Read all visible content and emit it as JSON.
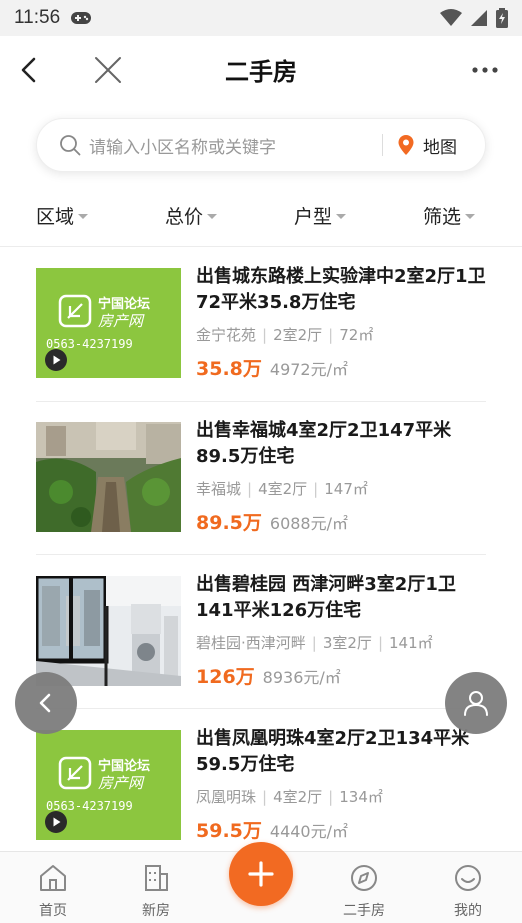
{
  "status_bar": {
    "time": "11:56"
  },
  "nav": {
    "title": "二手房"
  },
  "search": {
    "placeholder": "请输入小区名称或关键字",
    "map_label": "地图"
  },
  "filters": [
    "区域",
    "总价",
    "户型",
    "筛选"
  ],
  "listings": [
    {
      "title": "出售城东路楼上实验津中2室2厅1卫72平米35.8万住宅",
      "community": "金宁花苑",
      "layout": "2室2厅",
      "area": "72㎡",
      "price": "35.8万",
      "unit_price": "4972元/㎡",
      "thumb_brand": "宁国论坛",
      "thumb_sub": "房产网",
      "thumb_phone": "0563-4237199"
    },
    {
      "title": "出售幸福城4室2厅2卫147平米89.5万住宅",
      "community": "幸福城",
      "layout": "4室2厅",
      "area": "147㎡",
      "price": "89.5万",
      "unit_price": "6088元/㎡"
    },
    {
      "title": "出售碧桂园 西津河畔3室2厅1卫141平米126万住宅",
      "community": "碧桂园·西津河畔",
      "layout": "3室2厅",
      "area": "141㎡",
      "price": "126万",
      "unit_price": "8936元/㎡"
    },
    {
      "title": "出售凤凰明珠4室2厅2卫134平米59.5万住宅",
      "community": "凤凰明珠",
      "layout": "4室2厅",
      "area": "134㎡",
      "price": "59.5万",
      "unit_price": "4440元/㎡",
      "thumb_brand": "宁国论坛",
      "thumb_sub": "房产网",
      "thumb_phone": "0563-4237199"
    }
  ],
  "tabs": [
    {
      "label": "首页",
      "icon": "home-icon"
    },
    {
      "label": "新房",
      "icon": "building-icon"
    },
    {
      "label": "",
      "icon": "plus-icon"
    },
    {
      "label": "二手房",
      "icon": "compass-icon"
    },
    {
      "label": "我的",
      "icon": "smile-icon"
    }
  ],
  "colors": {
    "accent": "#f26a22",
    "price": "#f06a1f",
    "thumb_green": "#8cc63f"
  }
}
